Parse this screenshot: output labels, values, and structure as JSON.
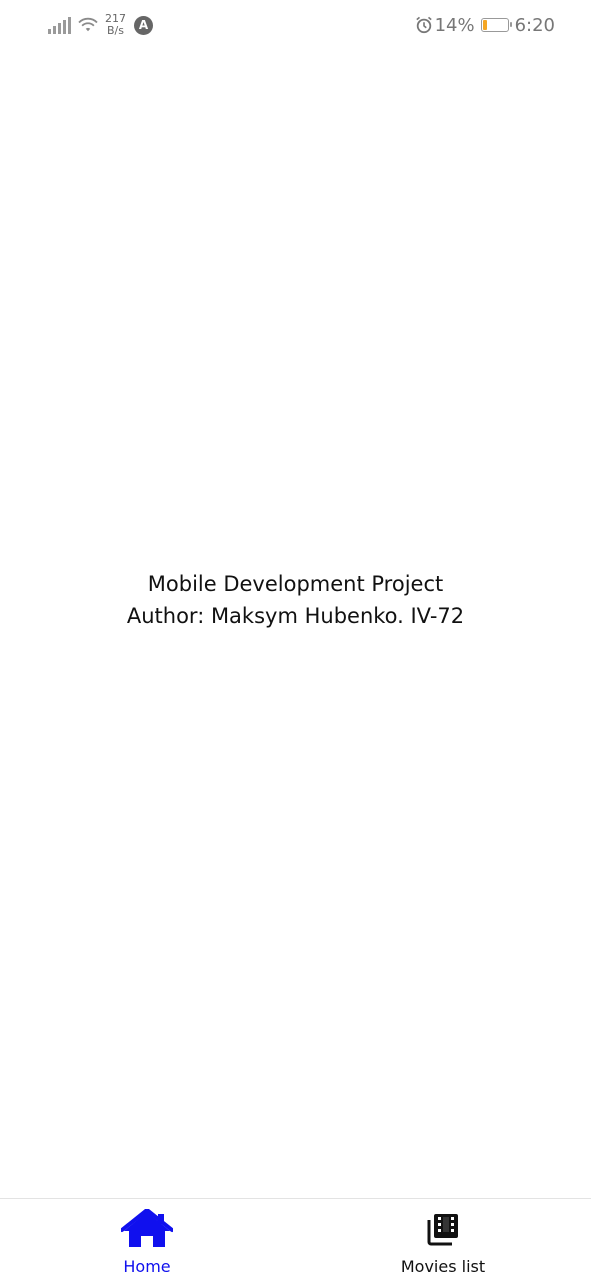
{
  "status_bar": {
    "net_speed_value": "217",
    "net_speed_unit": "B/s",
    "app_badge": "A",
    "battery_percent": "14%",
    "battery_level": 0.14,
    "time": "6:20"
  },
  "main": {
    "line1": "Mobile Development Project",
    "line2": "Author: Maksym Hubenko. IV-72"
  },
  "bottom_nav": {
    "items": [
      {
        "label": "Home",
        "icon": "home-icon",
        "active": true
      },
      {
        "label": "Movies list",
        "icon": "movie-library-icon",
        "active": false
      }
    ]
  },
  "colors": {
    "active": "#1010ee",
    "inactive": "#111111",
    "battery_low": "#f5a623"
  }
}
